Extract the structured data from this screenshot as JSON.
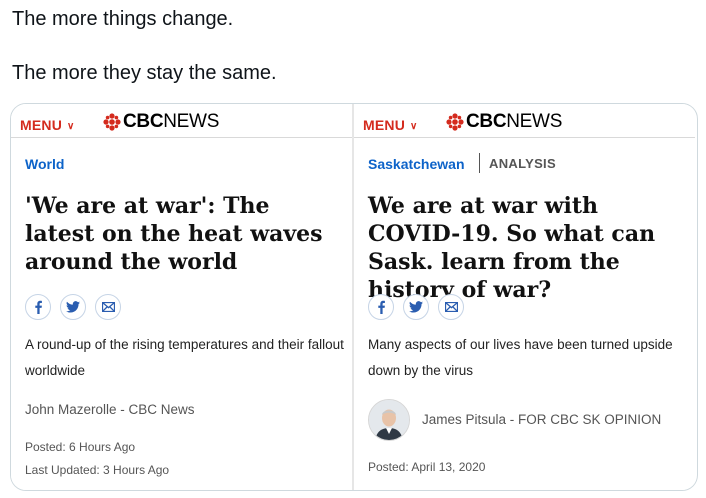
{
  "tweet": {
    "line1": "The more things change.",
    "line2": "The more they stay the same."
  },
  "cards": [
    {
      "menu_label": "MENU",
      "logo_cbc": "CBC",
      "logo_news": "NEWS",
      "section": "World",
      "headline": "'We are at war': The latest on the heat waves around the world",
      "summary": "A round-up of the rising temperatures and their fallout worldwide",
      "byline": "John Mazerolle - CBC News",
      "posted": "Posted: 6 Hours Ago",
      "updated": "Last Updated: 3 Hours Ago",
      "share_icons": [
        "facebook-icon",
        "twitter-icon",
        "email-icon"
      ]
    },
    {
      "menu_label": "MENU",
      "logo_cbc": "CBC",
      "logo_news": "NEWS",
      "section": "Saskatchewan",
      "label": "ANALYSIS",
      "headline": "We are at war with COVID-19. So what can Sask. learn from the history of war?",
      "summary": "Many aspects of our lives have been turned upside down by the virus",
      "byline": "James Pitsula - FOR CBC SK OPINION",
      "posted": "Posted: April 13, 2020",
      "share_icons": [
        "facebook-icon",
        "twitter-icon",
        "email-icon"
      ]
    }
  ],
  "colors": {
    "menu_red": "#d42b1e",
    "section_blue": "#0d63c9",
    "icon_blue": "#2a5db0"
  }
}
